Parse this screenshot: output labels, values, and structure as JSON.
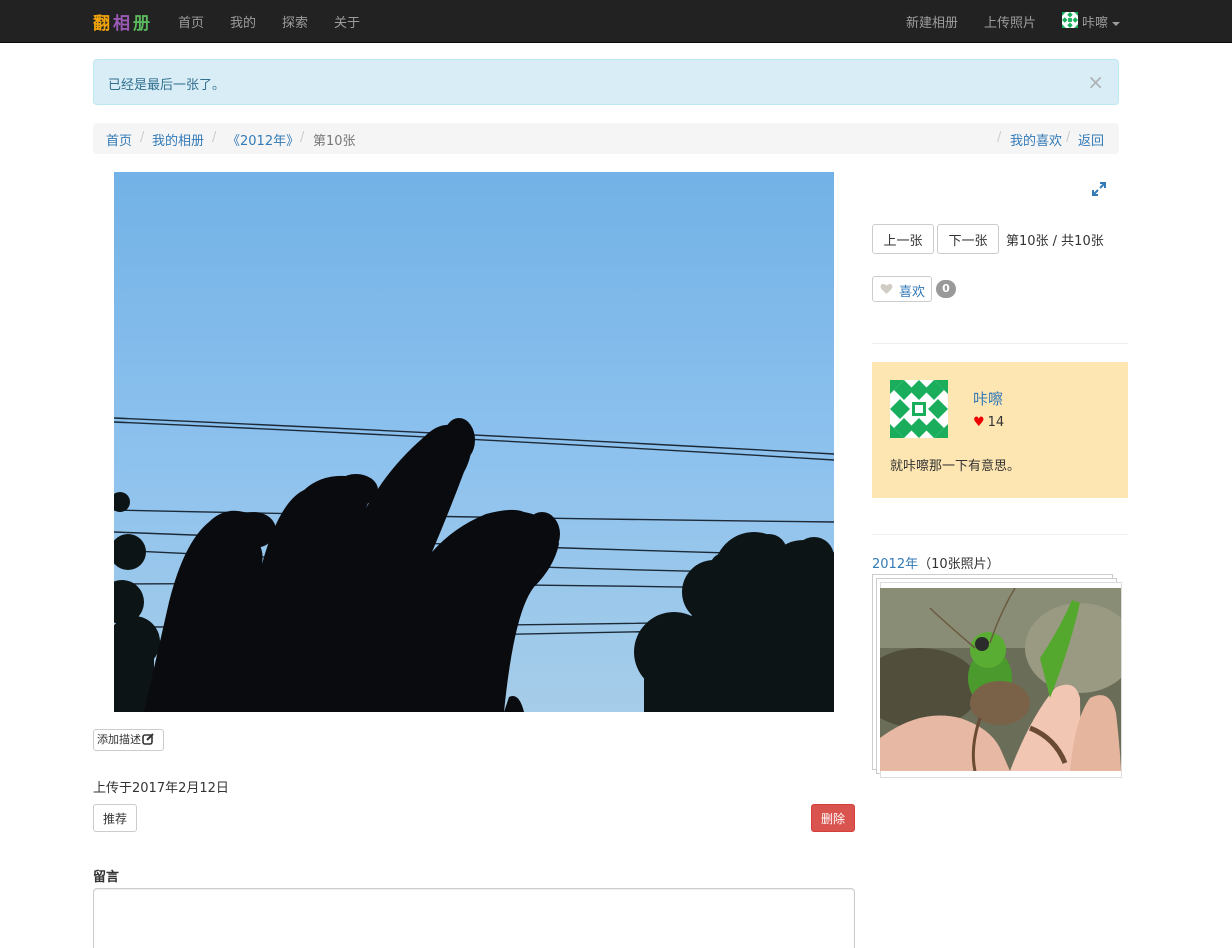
{
  "brand": {
    "chars": [
      "翻",
      "相",
      "册"
    ]
  },
  "nav": {
    "home": "首页",
    "mine": "我的",
    "explore": "探索",
    "about": "关于",
    "new_album": "新建相册",
    "upload": "上传照片",
    "username": "咔嚓"
  },
  "alert": {
    "text": "已经是最后一张了。",
    "close": "×"
  },
  "breadcrumb": {
    "items": [
      "首页",
      "我的相册",
      "《2012年》",
      "第10张"
    ],
    "right": [
      "我的喜欢",
      "返回"
    ],
    "separator": "/"
  },
  "photo": {
    "add_description": "添加描述",
    "uploaded": "上传于2017年2月12日",
    "recommend": "推荐",
    "delete": "删除"
  },
  "comments": {
    "label": "留言"
  },
  "sidebar": {
    "prev": "上一张",
    "next": "下一张",
    "position": "第10张 / 共10张",
    "like_label": "喜欢",
    "like_count": "0",
    "user": {
      "name": "咔嚓",
      "likes": "14",
      "bio": "就咔嚓那一下有意思。"
    },
    "album": {
      "name": "2012年",
      "count_text": "（10张照片）"
    }
  },
  "colors": {
    "navbar": "#222222",
    "link": "#337ab7",
    "alert_bg": "#d9edf7",
    "user_card_bg": "#fee6b2",
    "danger": "#d9534f",
    "avatar_green": "#1aad5c"
  }
}
